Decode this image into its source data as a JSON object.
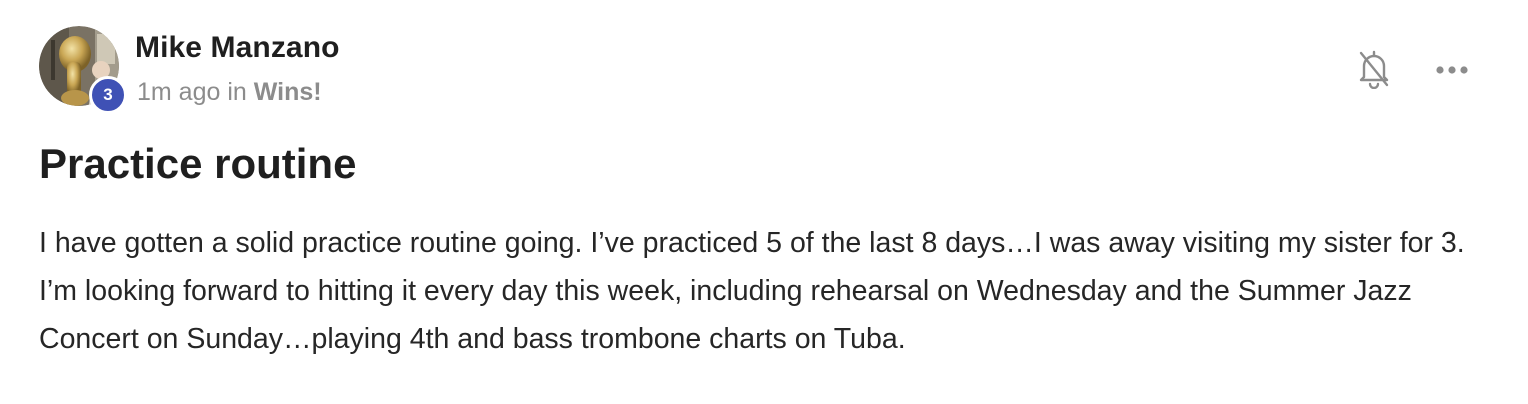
{
  "post": {
    "author": {
      "name": "Mike Manzano",
      "level": "3",
      "avatar": "tuba-player-photo"
    },
    "meta": {
      "time": "1m ago",
      "in_text": " in ",
      "space": "Wins!"
    },
    "actions": {
      "notifications_icon": "bell-off-icon",
      "more_icon": "more-horizontal-icon"
    },
    "title": "Practice routine",
    "body": "I have gotten a solid practice routine going. I’ve practiced 5 of the last 8 days…I was away visiting my sister for 3. I’m looking forward to hitting it every day this week, including rehearsal on Wednesday and the Summer Jazz Concert on Sunday…playing 4th and bass trombone charts on Tuba."
  },
  "colors": {
    "badge": "#3f51b5",
    "title": "#1f1f1f",
    "meta": "#8c8c8c",
    "icon": "#8c8c8c"
  }
}
